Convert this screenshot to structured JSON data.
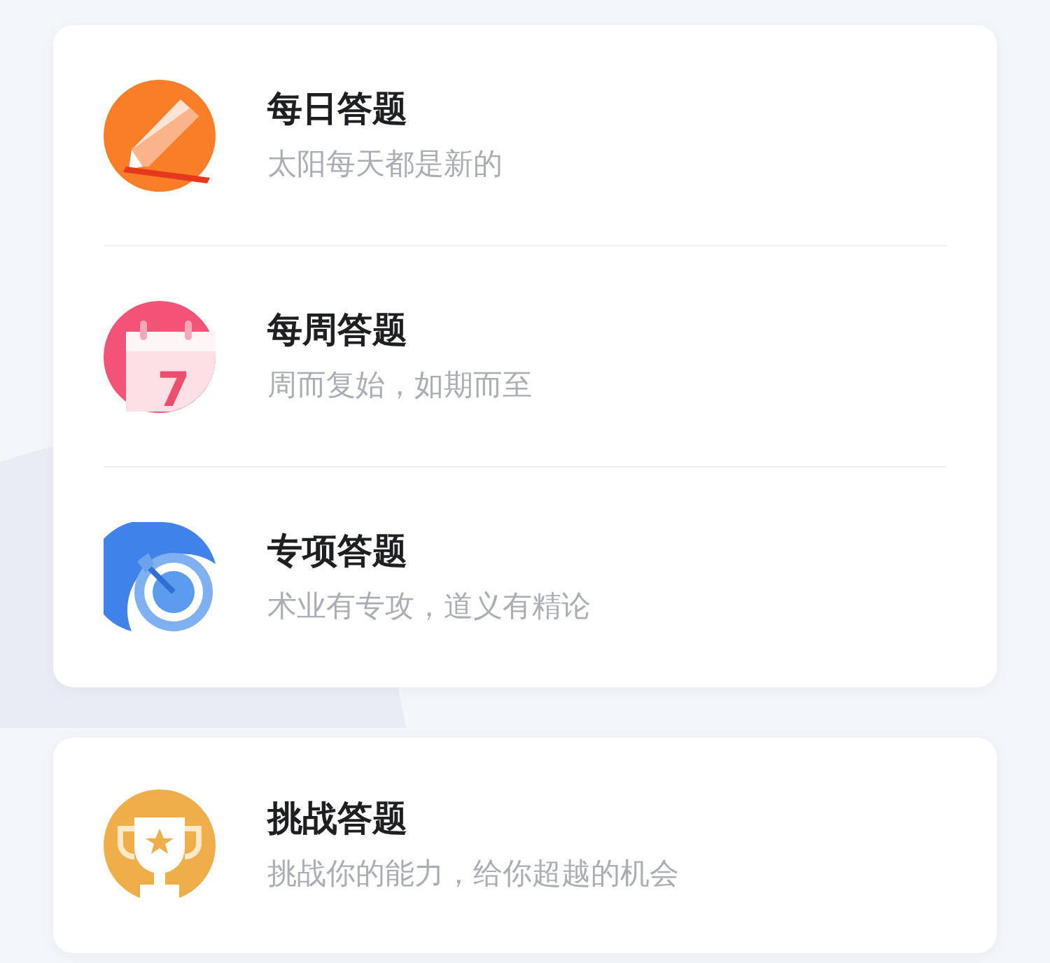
{
  "cards": [
    {
      "items": [
        {
          "kind": "pencil",
          "title": "每日答题",
          "subtitle": "太阳每天都是新的"
        },
        {
          "kind": "calendar",
          "title": "每周答题",
          "subtitle": "周而复始，如期而至",
          "icon_text": "7"
        },
        {
          "kind": "target",
          "title": "专项答题",
          "subtitle": "术业有专攻，道义有精论"
        }
      ]
    },
    {
      "items": [
        {
          "kind": "trophy",
          "title": "挑战答题",
          "subtitle": "挑战你的能力，给你超越的机会"
        }
      ]
    }
  ]
}
